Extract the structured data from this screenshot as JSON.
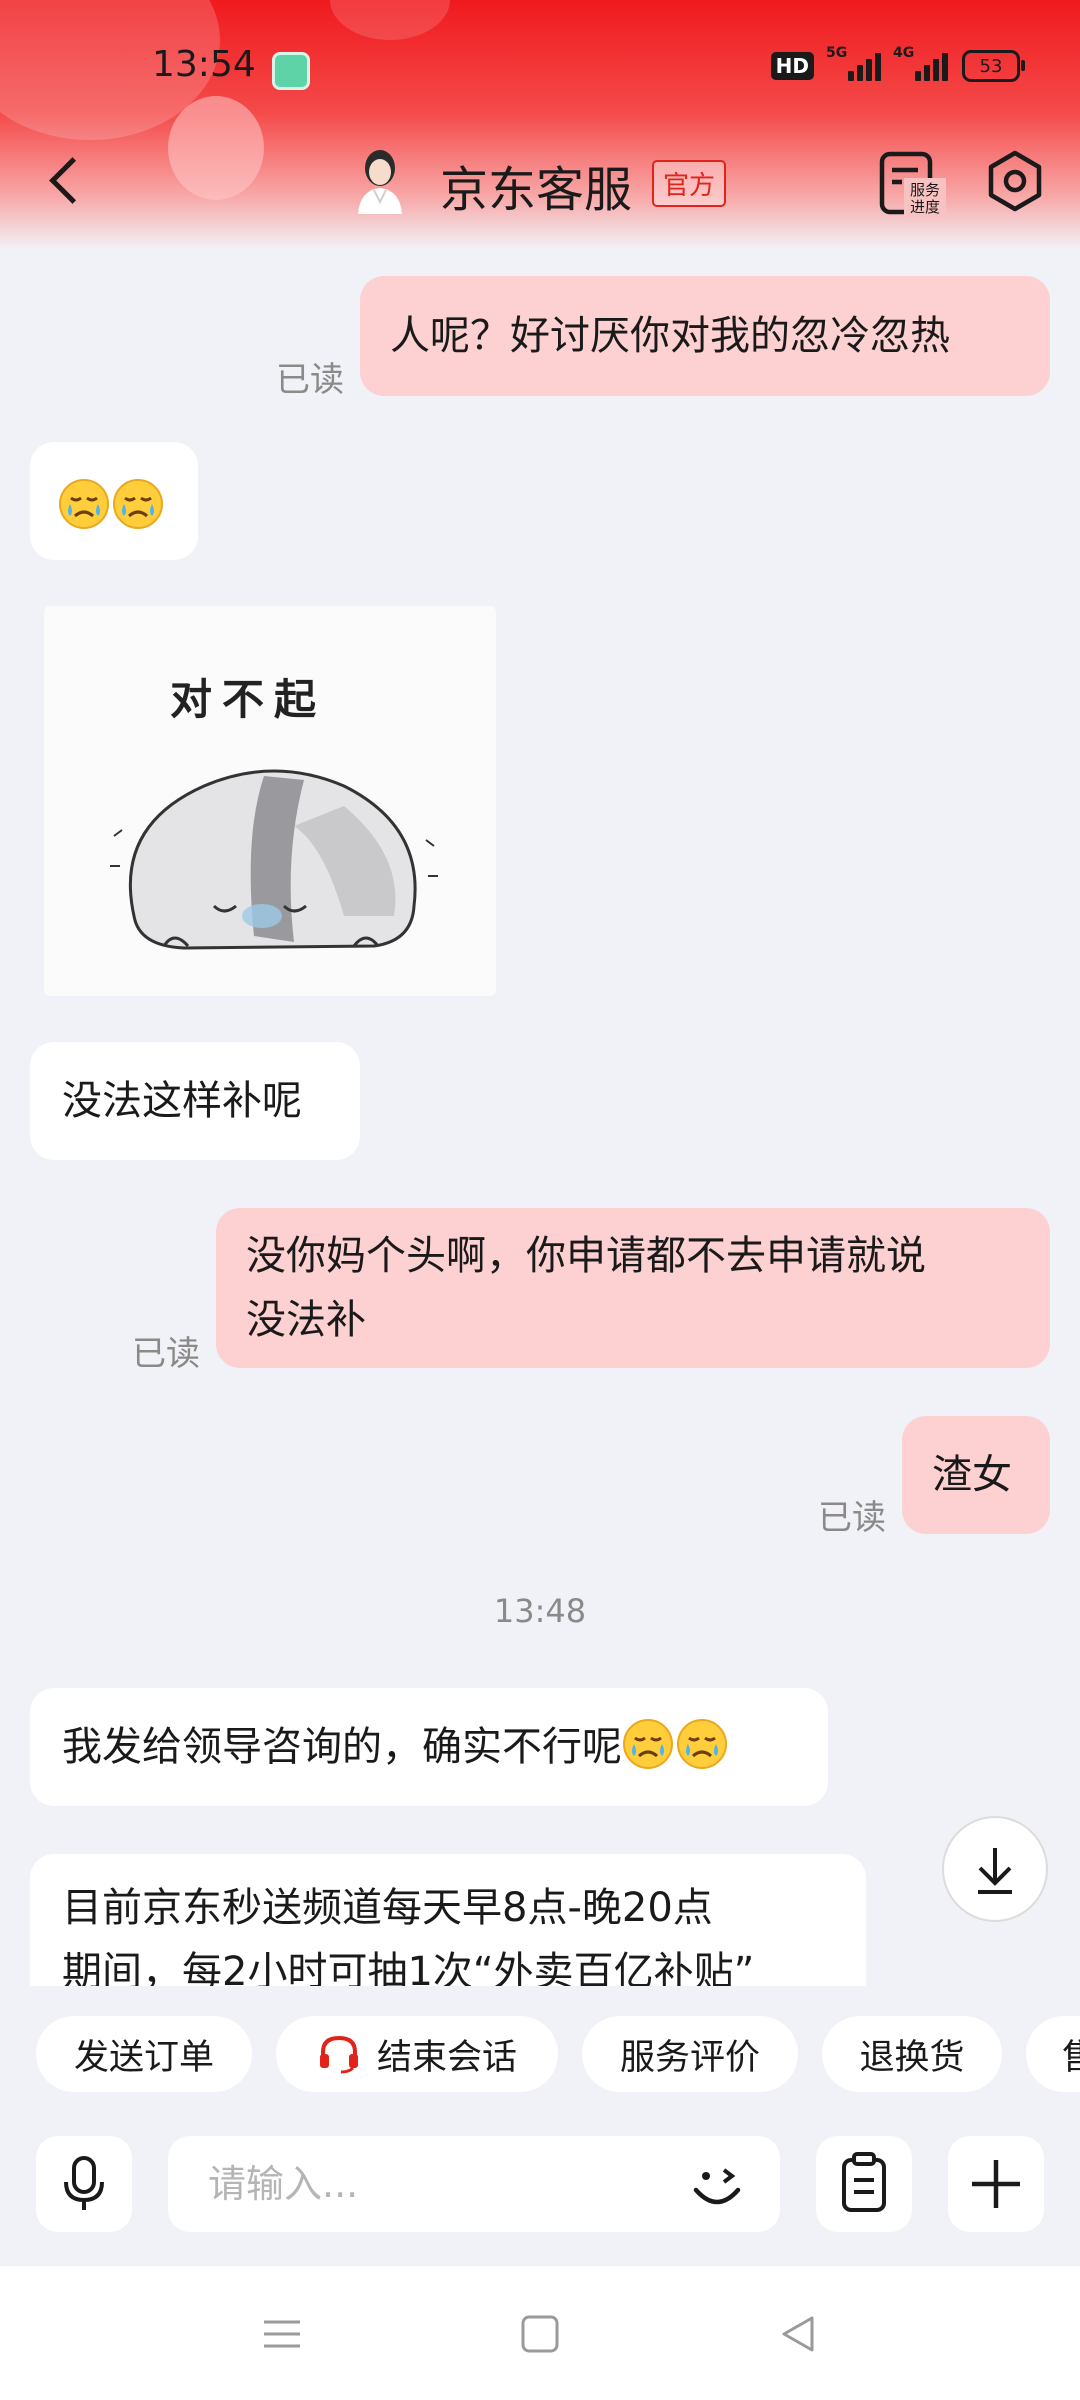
{
  "status_bar": {
    "time": "13:54",
    "hd_label": "HD",
    "net1_label": "5G",
    "net2_label": "4G",
    "battery": "53"
  },
  "header": {
    "title": "京东客服",
    "official_badge": "官方",
    "progress_label_line1": "服务",
    "progress_label_line2": "进度"
  },
  "messages": [
    {
      "from": "me",
      "text": "人呢？好讨厌你对我的忽冷忽热",
      "status": "已读"
    },
    {
      "from": "agent",
      "emojis": [
        "sad-crying-emoji",
        "sad-crying-emoji"
      ]
    },
    {
      "from": "agent",
      "sticker_text": "对不起"
    },
    {
      "from": "agent",
      "text": "没法这样补呢"
    },
    {
      "from": "me",
      "text_line1": "没你妈个头啊，你申请都不去申请就说",
      "text_line2": "没法补",
      "status": "已读"
    },
    {
      "from": "me",
      "text": "渣女",
      "status": "已读"
    },
    {
      "timestamp": "13:48"
    },
    {
      "from": "agent",
      "text": "我发给领导咨询的，确实不行呢"
    },
    {
      "from": "agent",
      "text_line1": "目前京东秒送频道每天早8点-晚20点",
      "text_line2": "期间，每2小时可抽1次“外卖百亿补贴”"
    }
  ],
  "quick_replies": [
    "发送订单",
    "结束会话",
    "服务评价",
    "退换货",
    "售"
  ],
  "input": {
    "placeholder": "请输入..."
  },
  "colors": {
    "brand_red": "#e2231a",
    "my_bubble": "#fdd1d1",
    "agent_bubble": "#ffffff",
    "background": "#f1f2f7"
  }
}
